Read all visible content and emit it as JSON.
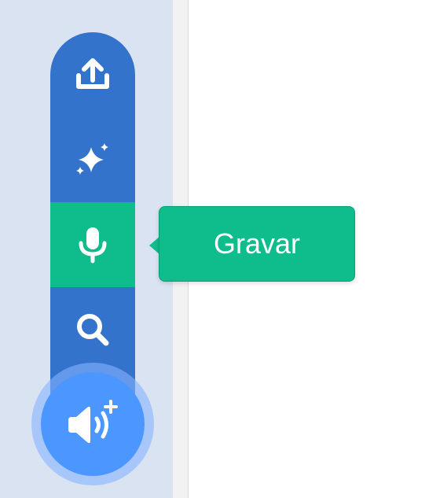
{
  "sound_menu": {
    "items": [
      {
        "icon": "upload-icon"
      },
      {
        "icon": "sparkle-icon"
      },
      {
        "icon": "microphone-icon",
        "active": true
      },
      {
        "icon": "search-icon"
      }
    ],
    "tooltip": "Gravar",
    "main_button_icon": "speaker-plus-icon"
  },
  "colors": {
    "menu_blue": "#3373cc",
    "active_green": "#0fbd8c",
    "main_button_blue": "#4c97ff",
    "panel_bg": "#dae3f2"
  }
}
